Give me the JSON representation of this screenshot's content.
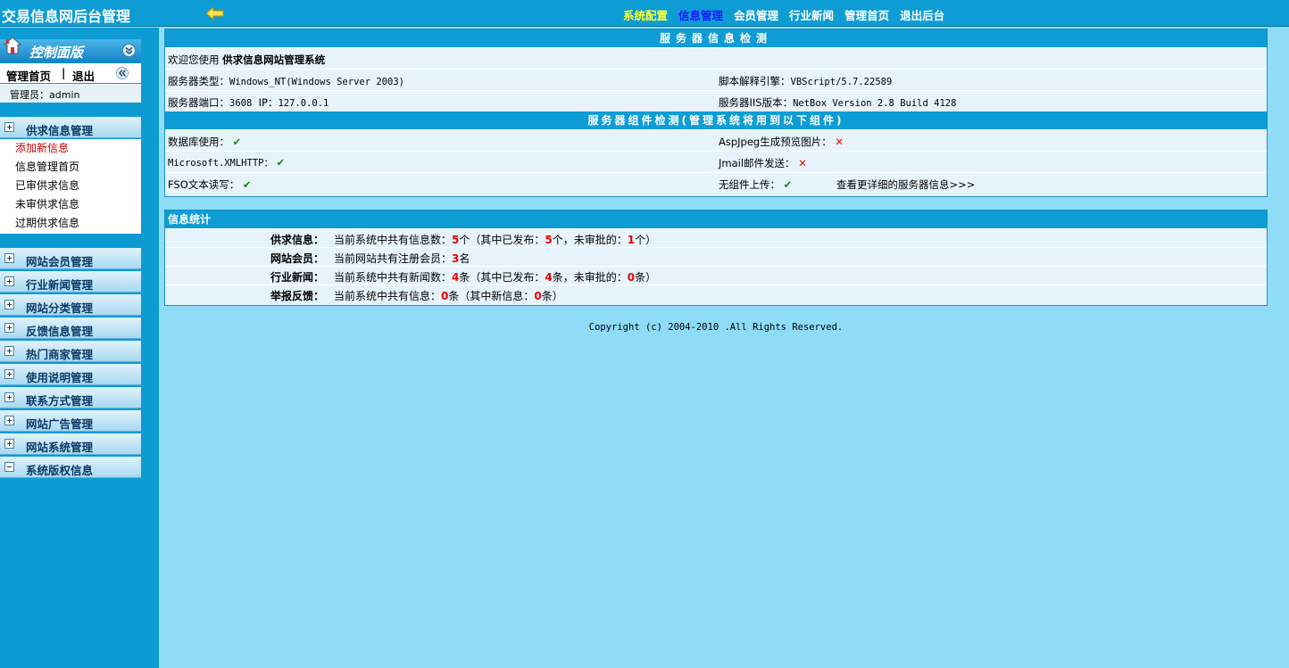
{
  "header": {
    "title": "交易信息网后台管理",
    "nav": [
      {
        "label": "系统配置",
        "style": "yellow"
      },
      {
        "label": "信息管理",
        "style": "blue"
      },
      {
        "label": "会员管理",
        "style": "normal"
      },
      {
        "label": "行业新闻",
        "style": "normal"
      },
      {
        "label": "管理首页",
        "style": "normal"
      },
      {
        "label": "退出后台",
        "style": "normal"
      }
    ]
  },
  "sidebar": {
    "panel_title": "控制面版",
    "home_label": "管理首页",
    "separator": "|",
    "logout_label": "退出",
    "admin_label": "管理员：admin",
    "open_section": "供求信息管理",
    "open_items": [
      "添加新信息",
      "信息管理首页",
      "已审供求信息",
      "未审供求信息",
      "过期供求信息"
    ],
    "sections": [
      "网站会员管理",
      "行业新闻管理",
      "网站分类管理",
      "反馈信息管理",
      "热门商家管理",
      "使用说明管理",
      "联系方式管理",
      "网站广告管理",
      "网站系统管理",
      "系统版权信息"
    ]
  },
  "server": {
    "title": "服务器信息检测",
    "welcome_prefix": "欢迎您使用",
    "system_name": "供求信息网站管理系统",
    "os_label": "服务器类型：",
    "os_value": "Windows_NT(Windows Server 2003)",
    "script_label": "脚本解释引擎：",
    "script_value": "VBScript/5.7.22589",
    "port_label": "服务器端口：",
    "port_value": "3608",
    "ip_label": "IP：",
    "ip_value": "127.0.0.1",
    "iis_label": "服务器IIS版本：",
    "iis_value": "NetBox Version 2.8 Build 4128"
  },
  "components": {
    "title": "服务器组件检测(管理系统将用到以下组件)",
    "db_label": "数据库使用：",
    "aspjpeg_label": "AspJpeg生成预览图片：",
    "xmlhttp_label": "Microsoft.XMLHTTP：",
    "jmail_label": "Jmail邮件发送：",
    "fso_label": "FSO文本读写：",
    "upload_label": "无组件上传：",
    "more_link": "查看更详细的服务器信息>>>",
    "check_glyph": "✔",
    "cross_glyph": "✕"
  },
  "stats": {
    "title": "信息统计",
    "rows": [
      {
        "label": "供求信息：",
        "pre": "当前系统中共有信息数：",
        "n1": "5",
        "mid1": "个（其中已发布：",
        "n2": "5",
        "mid2": "个，未审批的：",
        "n3": "1",
        "end": "个）"
      },
      {
        "label": "网站会员：",
        "pre": "当前网站共有注册会员：",
        "n1": "3",
        "mid1": "名",
        "n2": "",
        "mid2": "",
        "n3": "",
        "end": ""
      },
      {
        "label": "行业新闻：",
        "pre": "当前系统中共有新闻数：",
        "n1": "4",
        "mid1": "条（其中已发布：",
        "n2": "4",
        "mid2": "条，未审批的：",
        "n3": "0",
        "end": "条）"
      },
      {
        "label": "举报反馈：",
        "pre": "当前系统中共有信息：",
        "n1": "0",
        "mid1": "条（其中新信息：",
        "n2": "0",
        "mid2": "条）",
        "n3": "",
        "end": ""
      }
    ]
  },
  "footer": {
    "copyright": "Copyright (c) 2004-2010 .All Rights Reserved."
  },
  "colors": {
    "accent": "#0d9dd4",
    "page_bg": "#8fdcf6",
    "sidebar_bg": "#0c9bd3",
    "highlight_red": "#ee0000"
  }
}
